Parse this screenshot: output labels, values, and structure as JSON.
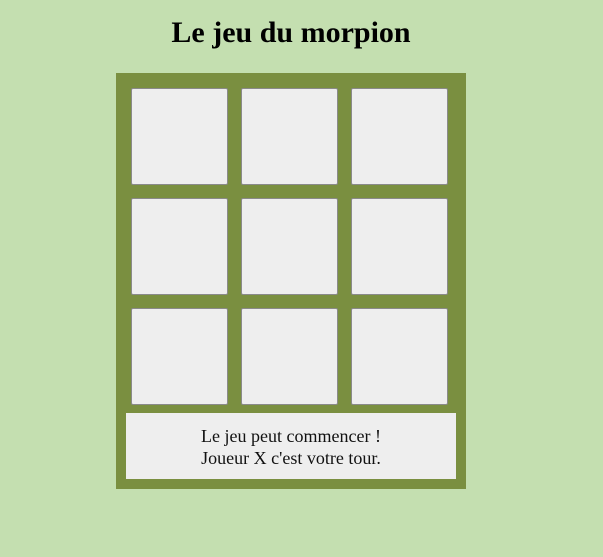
{
  "page": {
    "title": "Le jeu du morpion"
  },
  "board": {
    "cells": [
      "",
      "",
      "",
      "",
      "",
      "",
      "",
      "",
      ""
    ]
  },
  "status": {
    "line1": "Le jeu peut commencer !",
    "line2": "Joueur X c'est votre tour."
  },
  "colors": {
    "background": "#c4dfb0",
    "board": "#7a8f40",
    "cell": "#eeeeee"
  }
}
